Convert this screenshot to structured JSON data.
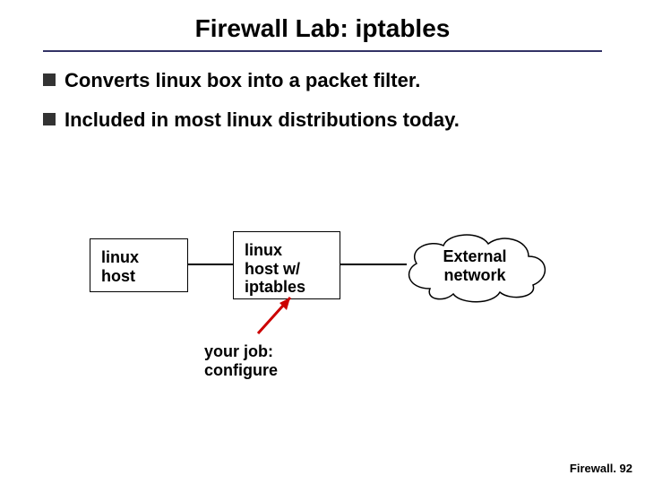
{
  "title": "Firewall Lab: iptables",
  "bullets": {
    "b1": "Converts linux box into a packet filter.",
    "b2": "Included in most linux distributions today."
  },
  "diagram": {
    "box1": "linux\nhost",
    "box2": "linux\nhost w/\niptables",
    "cloud": "External\nnetwork"
  },
  "annotation": "your job:\nconfigure",
  "footer": "Firewall. 92"
}
